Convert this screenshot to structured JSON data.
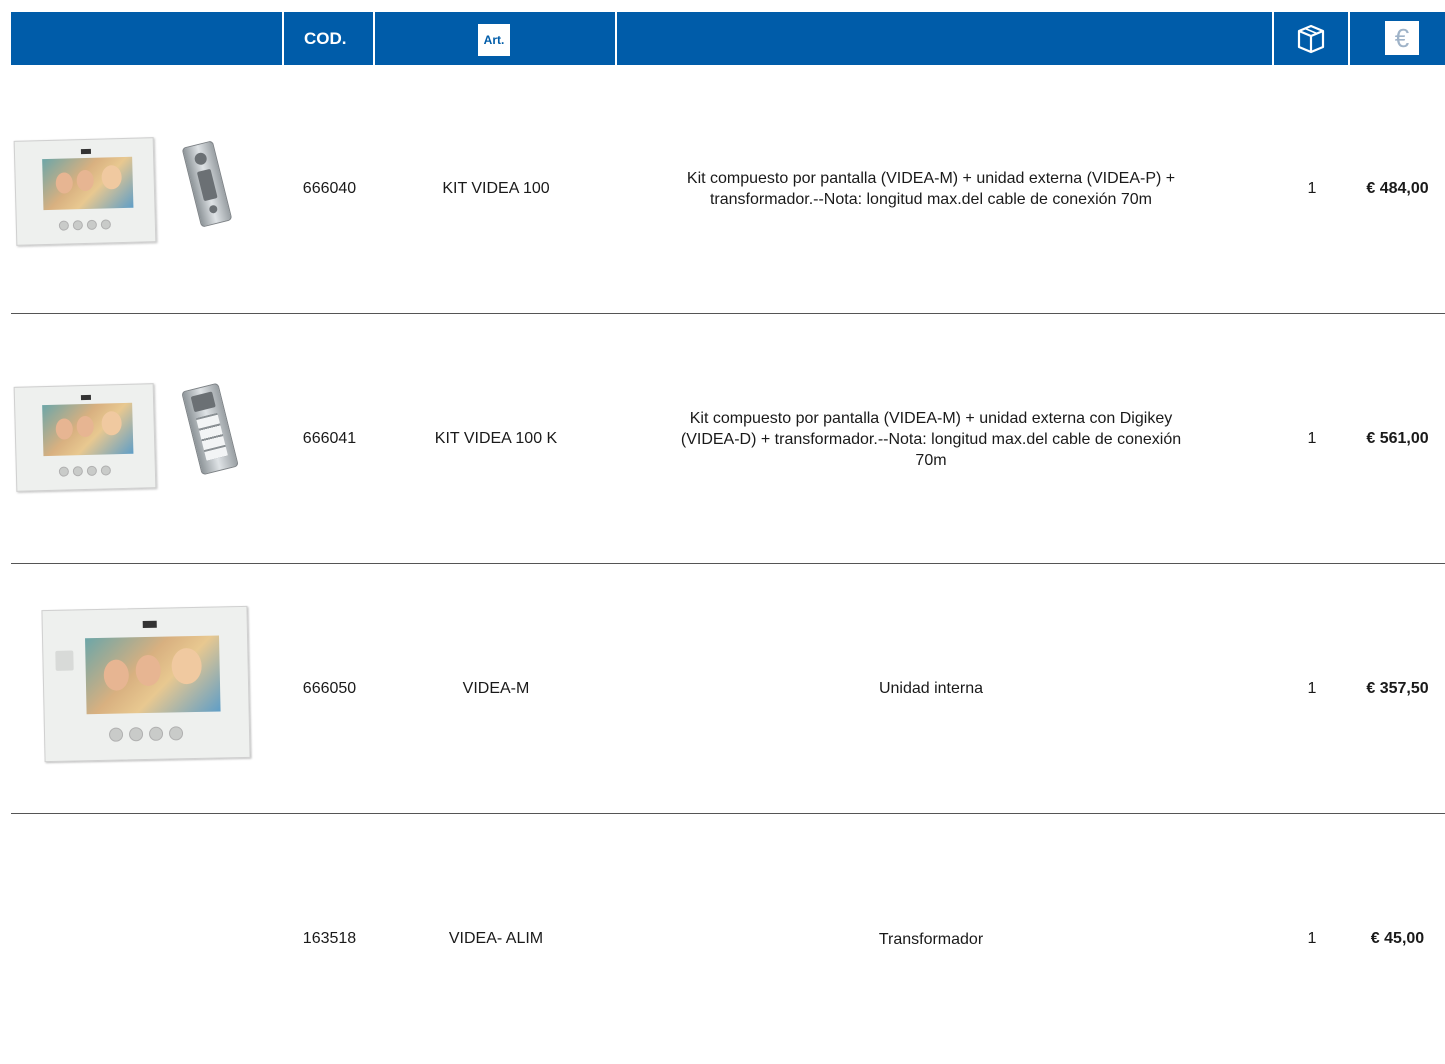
{
  "header": {
    "cod_label": "COD.",
    "art_label": "Art.",
    "qty_icon": "box-icon",
    "price_icon": "euro-icon",
    "euro_symbol": "€",
    "color": "#005ca9"
  },
  "rows": [
    {
      "code": "666040",
      "article": "KIT VIDEA 100",
      "description": [
        "Kit compuesto por pantalla (VIDEA-M) + unidad externa (VIDEA-P) +",
        "transformador.--Nota: longitud max.del cable de conexión 70m"
      ],
      "quantity": "1",
      "price": "€ 484,00"
    },
    {
      "code": "666041",
      "article": "KIT VIDEA 100 K",
      "description": [
        "Kit compuesto por pantalla (VIDEA-M) + unidad externa con Digikey",
        "(VIDEA-D) + transformador.--Nota: longitud max.del cable de conexión",
        "70m"
      ],
      "quantity": "1",
      "price": "€ 561,00"
    },
    {
      "code": "666050",
      "article": "VIDEA-M",
      "description": [
        "Unidad interna"
      ],
      "quantity": "1",
      "price": "€ 357,50"
    },
    {
      "code": "163518",
      "article": "VIDEA- ALIM",
      "description": [
        "Transformador"
      ],
      "quantity": "1",
      "price": "€ 45,00"
    }
  ]
}
